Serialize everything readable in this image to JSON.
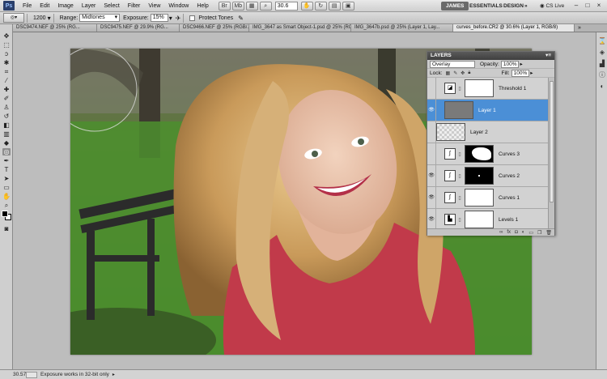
{
  "menubar": {
    "app_logo": "Ps",
    "items": [
      "File",
      "Edit",
      "Image",
      "Layer",
      "Select",
      "Filter",
      "View",
      "Window",
      "Help"
    ],
    "zoom_value": "30.6",
    "workspaces": [
      "JAMES",
      "ESSENTIALS",
      "DESIGN",
      "»"
    ],
    "cs_live": "CS Live",
    "window_controls": [
      "–",
      "□",
      "×"
    ]
  },
  "options": {
    "brush_size": "1200",
    "range_label": "Range:",
    "range_value": "Midtones",
    "exposure_label": "Exposure:",
    "exposure_value": "15%",
    "protect_tones_label": "Protect Tones"
  },
  "tabs": [
    "DSC9474.NEF @ 25% (RG...",
    "DSC9475.NEF @ 29.9% (RG...",
    "DSC9466.NEF @ 25% (RGB/...",
    "IMG_3647 as Smart Object-1.psd @ 25% (RGB/...",
    "IMG_3647b.psd @ 25% (Layer 1, Lay...",
    "curves_before.CR2 @ 30.6% (Layer 1, RGB/8)"
  ],
  "layers_panel": {
    "title": "LAYERS",
    "blend_mode": "Overlay",
    "opacity_label": "Opacity:",
    "opacity_value": "100%",
    "lock_label": "Lock:",
    "fill_label": "Fill:",
    "fill_value": "100%",
    "layers": [
      {
        "name": "Threshold 1",
        "thumb": "white",
        "adjustment": true,
        "visible": false,
        "selected": false
      },
      {
        "name": "Layer 1",
        "thumb": "gray",
        "adjustment": false,
        "visible": true,
        "selected": true
      },
      {
        "name": "Layer 2",
        "thumb": "checker",
        "adjustment": false,
        "visible": false,
        "selected": false
      },
      {
        "name": "Curves 3",
        "thumb": "mask-a",
        "adjustment": true,
        "visible": false,
        "selected": false
      },
      {
        "name": "Curves 2",
        "thumb": "black",
        "adjustment": true,
        "visible": true,
        "selected": false
      },
      {
        "name": "Curves 1",
        "thumb": "white",
        "adjustment": true,
        "visible": true,
        "selected": false
      },
      {
        "name": "Levels 1",
        "thumb": "white",
        "adjustment": true,
        "visible": true,
        "selected": false
      }
    ]
  },
  "status": {
    "zoom": "30.57%",
    "message": "Exposure works in 32-bit only"
  },
  "colors": {
    "selection_blue": "#4b8fd6",
    "panel_gray": "#cbcbcb",
    "canvas_gray": "#bdbdbd"
  }
}
